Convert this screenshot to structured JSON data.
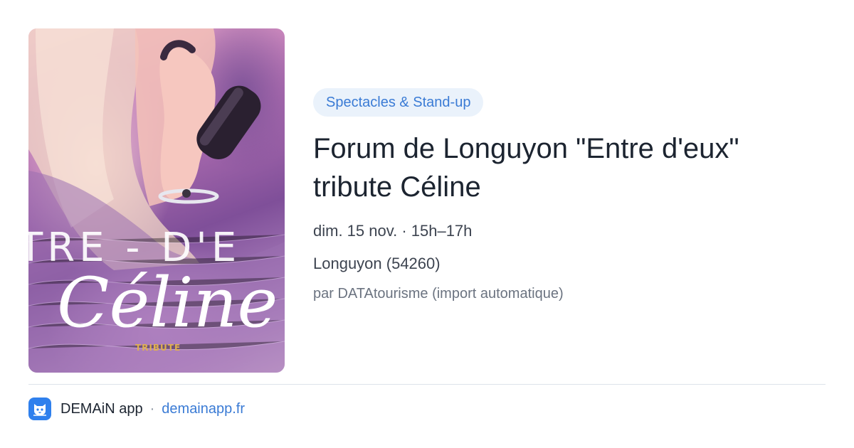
{
  "poster": {
    "headline_text": "TRE - D'E",
    "script_text": "Céline",
    "tribute_text": "TRIBUTE"
  },
  "event": {
    "category": "Spectacles & Stand-up",
    "title": "Forum de Longuyon \"Entre d'eux\" tribute Céline",
    "date_time": "dim. 15 nov. · 15h–17h",
    "location": "Longuyon (54260)",
    "source": "par DATAtourisme (import automatique)"
  },
  "footer": {
    "app_name": "DEMAiN app",
    "separator": "·",
    "link": "demainapp.fr"
  },
  "colors": {
    "accent": "#3a7bd5",
    "pill_background": "#eaf2fb",
    "title": "#1c2430",
    "app_icon": "#2f80ed"
  },
  "icons": {
    "app_icon": "cat-face-icon"
  }
}
